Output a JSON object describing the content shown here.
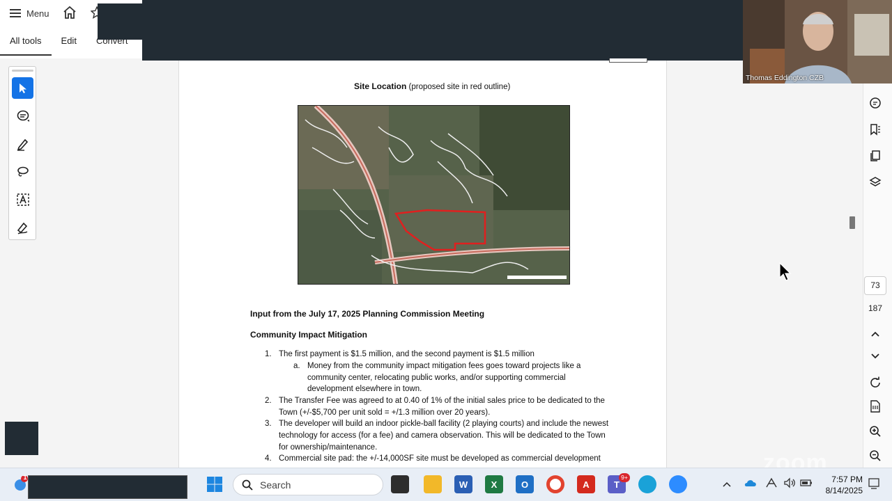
{
  "toolbar": {
    "menu_label": "Menu",
    "tabs": [
      "All tools",
      "Edit",
      "Convert"
    ]
  },
  "document": {
    "site_heading": "Site Location",
    "site_caption": "(proposed site in red outline)",
    "input_heading": "Input from the July 17, 2025 Planning Commission Meeting",
    "section_heading": "Community Impact Mitigation",
    "items": [
      {
        "num": "1.",
        "lines": [
          "The first payment is $1.5 million, and the second payment is $1.5 million"
        ]
      },
      {
        "num": "a.",
        "lines": [
          "Money from the community impact mitigation fees goes toward projects like a",
          "community center, relocating public works, and/or supporting commercial",
          "development elsewhere in town."
        ]
      },
      {
        "num": "2.",
        "lines": [
          "The Transfer Fee was agreed to at 0.40 of 1% of the initial sales price to be dedicated to the",
          "Town (+/-$5,700 per unit sold = +/1.3 million over 20 years)."
        ]
      },
      {
        "num": "3.",
        "lines": [
          "The developer will build an indoor pickle-ball facility (2 playing courts) and include the newest",
          "technology for access (for a fee) and camera observation. This will be dedicated to the Town",
          "for ownership/maintenance."
        ]
      },
      {
        "num": "4.",
        "lines": [
          "Commercial site pad: the +/-14,000SF site must be developed as commercial development"
        ]
      }
    ]
  },
  "page_nav": {
    "current": "73",
    "total": "187"
  },
  "video": {
    "participant_name": "Thomas Eddington CZB"
  },
  "taskbar": {
    "search_placeholder": "Search",
    "time": "7:57 PM",
    "date": "8/14/2025",
    "widget_badge": "1",
    "teams_badge": "9+"
  },
  "watermark": "zoom",
  "colors": {
    "accent": "#1473e6",
    "outline_red": "#e0201f",
    "dark_header": "#222c34"
  }
}
